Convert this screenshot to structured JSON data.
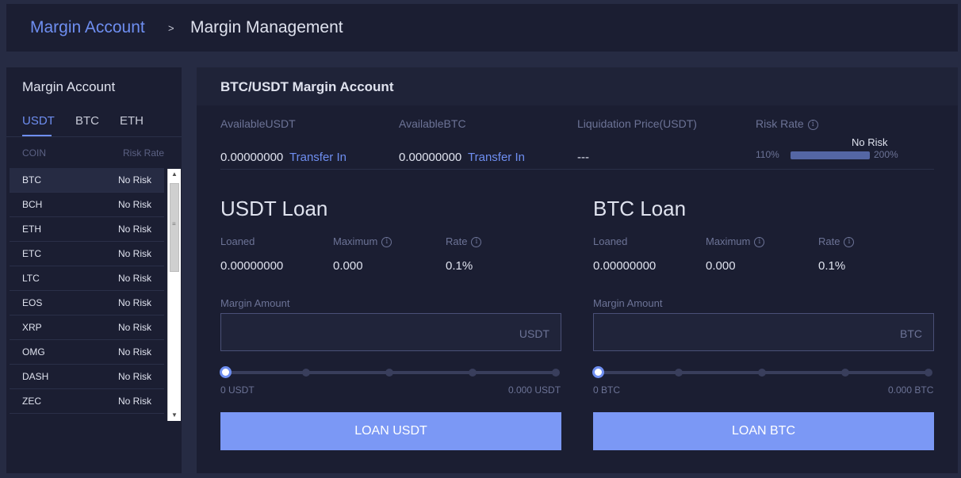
{
  "breadcrumb": {
    "parent": "Margin Account",
    "separator": ">",
    "current": "Margin Management"
  },
  "sidebar": {
    "title": "Margin Account",
    "tabs": [
      "USDT",
      "BTC",
      "ETH"
    ],
    "active_tab": "USDT",
    "columns": {
      "coin": "COIN",
      "risk": "Risk Rate"
    },
    "rows": [
      {
        "coin": "BTC",
        "risk": "No Risk"
      },
      {
        "coin": "BCH",
        "risk": "No Risk"
      },
      {
        "coin": "ETH",
        "risk": "No Risk"
      },
      {
        "coin": "ETC",
        "risk": "No Risk"
      },
      {
        "coin": "LTC",
        "risk": "No Risk"
      },
      {
        "coin": "EOS",
        "risk": "No Risk"
      },
      {
        "coin": "XRP",
        "risk": "No Risk"
      },
      {
        "coin": "OMG",
        "risk": "No Risk"
      },
      {
        "coin": "DASH",
        "risk": "No Risk"
      },
      {
        "coin": "ZEC",
        "risk": "No Risk"
      }
    ],
    "selected_coin": "BTC"
  },
  "account": {
    "title": "BTC/USDT Margin Account",
    "available_usdt_label": "AvailableUSDT",
    "available_usdt_value": "0.00000000",
    "available_btc_label": "AvailableBTC",
    "available_btc_value": "0.00000000",
    "transfer_in": "Transfer In",
    "liquidation_label": "Liquidation Price(USDT)",
    "liquidation_value": "---",
    "risk_rate_label": "Risk Rate",
    "risk_status": "No Risk",
    "risk_min": "110%",
    "risk_max": "200%",
    "info_glyph": "i"
  },
  "usdt_loan": {
    "title": "USDT Loan",
    "loaned_label": "Loaned",
    "loaned_value": "0.00000000",
    "maximum_label": "Maximum",
    "maximum_value": "0.000",
    "rate_label": "Rate",
    "rate_value": "0.1%",
    "amount_label": "Margin Amount",
    "unit": "USDT",
    "slider_min": "0 USDT",
    "slider_max": "0.000 USDT",
    "slider_level": 0,
    "button": "LOAN USDT"
  },
  "btc_loan": {
    "title": "BTC Loan",
    "loaned_label": "Loaned",
    "loaned_value": "0.00000000",
    "maximum_label": "Maximum",
    "maximum_value": "0.000",
    "rate_label": "Rate",
    "rate_value": "0.1%",
    "amount_label": "Margin Amount",
    "unit": "BTC",
    "slider_min": "0 BTC",
    "slider_max": "0.000 BTC",
    "slider_level": 0,
    "button": "LOAN BTC"
  },
  "colors": {
    "accent": "#6e8ef0",
    "button": "#7b98f5",
    "panel": "#1b1e32",
    "background": "#262b43"
  }
}
